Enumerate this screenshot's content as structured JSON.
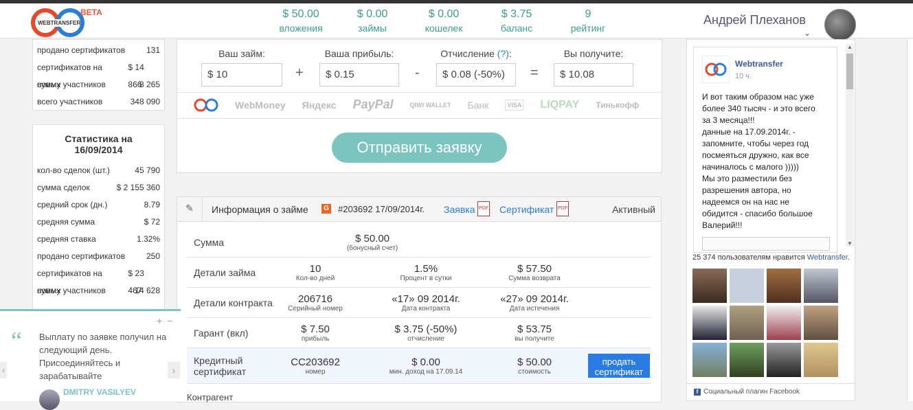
{
  "header": {
    "beta": "BETA",
    "logo_text": "WEBTRANSFER",
    "stats": [
      {
        "value": "$ 50.00",
        "label": "вложения"
      },
      {
        "value": "$ 0.00",
        "label": "займы"
      },
      {
        "value": "$ 0.00",
        "label": "кошелек"
      },
      {
        "value": "$ 3.75",
        "label": "баланс"
      },
      {
        "value": "9",
        "label": "рейтинг"
      }
    ],
    "user_name": "Андрей Плеханов"
  },
  "left_top": [
    {
      "label": "продано сертификатов",
      "value": "131"
    },
    {
      "label": "сертификатов на сумму",
      "value": "$ 14 866"
    },
    {
      "label": "новых участников",
      "value": "8 265"
    },
    {
      "label": "всего участников",
      "value": "348 090"
    }
  ],
  "left_stats": {
    "title_line1": "Статистика на",
    "title_line2": "16/09/2014",
    "rows": [
      {
        "label": "кол-во сделок (шт.)",
        "value": "45 790"
      },
      {
        "label": "сумма сделок",
        "value": "$ 2 155 360"
      },
      {
        "label": "средний срок (дн.)",
        "value": "8.79"
      },
      {
        "label": "средняя сумма",
        "value": "$ 72"
      },
      {
        "label": "средняя ставка",
        "value": "1.32%"
      },
      {
        "label": "продано сертификатов",
        "value": "250"
      },
      {
        "label": "сертификатов на сумму",
        "value": "$ 23 467"
      },
      {
        "label": "новых участников",
        "value": "14 628"
      }
    ]
  },
  "form": {
    "loan_label": "Ваш займ:",
    "loan_value": "$ 10",
    "profit_label": "Ваша прибыль:",
    "profit_value": "$ 0.15",
    "fee_label": "Отчисление",
    "fee_q": "(?)",
    "fee_colon": ":",
    "fee_value": "$ 0.08 (-50%)",
    "get_label": "Вы получите:",
    "get_value": "$ 10.08",
    "plus": "+",
    "minus": "-",
    "equals": "=",
    "payments": [
      "WebMoney",
      "Яндекс",
      "PayPal",
      "QIWI WALLET",
      "Банк",
      "VISA",
      "LIQPAY",
      "Тинькофф"
    ],
    "submit": "Отправить заявку"
  },
  "info": {
    "title": "Информация о займе",
    "badge": "G",
    "number": "#203692 17/09/2014г.",
    "link_request": "Заявка",
    "link_cert": "Сертификат",
    "status": "Активный",
    "rows": [
      {
        "label": "Сумма",
        "cells": [
          {
            "a": "$ 50.00",
            "b": "(бонусный счет)"
          }
        ]
      },
      {
        "label": "Детали займа",
        "cells": [
          {
            "a": "10",
            "b": "Кол-во дней"
          },
          {
            "a": "1.5%",
            "b": "Процент в сутки"
          },
          {
            "a": "$ 57.50",
            "b": "Сумма возврата"
          }
        ]
      },
      {
        "label": "Детали контракта",
        "cells": [
          {
            "a": "206716",
            "b": "Серийный номер"
          },
          {
            "a": "«17» 09 2014г.",
            "b": "Дата контракта"
          },
          {
            "a": "«27» 09 2014г.",
            "b": "Дата истечения"
          }
        ]
      },
      {
        "label": "Гарант (вкл)",
        "cells": [
          {
            "a": "$ 7.50",
            "b": "прибыль"
          },
          {
            "a": "$ 3.75 (-50%)",
            "b": "отчисление"
          },
          {
            "a": "$ 53.75",
            "b": "вы получите"
          }
        ]
      },
      {
        "label": "Кредитный сертификат",
        "cells": [
          {
            "a": "CC203692",
            "b": "номер"
          },
          {
            "a": "$ 0.00",
            "b": "мин. доход на 17.09.14"
          },
          {
            "a": "$ 50.00",
            "b": "стоимость"
          }
        ]
      }
    ],
    "sell_button": "продать сертификат",
    "next_label": "Контрагент"
  },
  "facebook": {
    "page_name": "Webtransfer",
    "time": "10 ч.",
    "post_text": "И вот таким образом нас уже более 340 тысяч - и это всего за 3 месяца!!!\nданные на 17.09.2014г. - запомните, чтобы через год посмеяться дружно, как все начиналось с малого )))))\nМы это разместили без разрешения автора, но надеемся он на нас не обидится - спасибо большое Валерий!!!",
    "likes_text": "25 374 пользователям нравится",
    "likes_link": "Webtransfer",
    "likes_dot": ".",
    "footer": "Социальный плагин Facebook"
  },
  "testimonial": {
    "quote": "Выплату по заявке получил на следующий день. Присоединяйтесь и зарабатывайте",
    "author": "DMITRY VASILYEV",
    "plus": "+",
    "minus": "−"
  }
}
